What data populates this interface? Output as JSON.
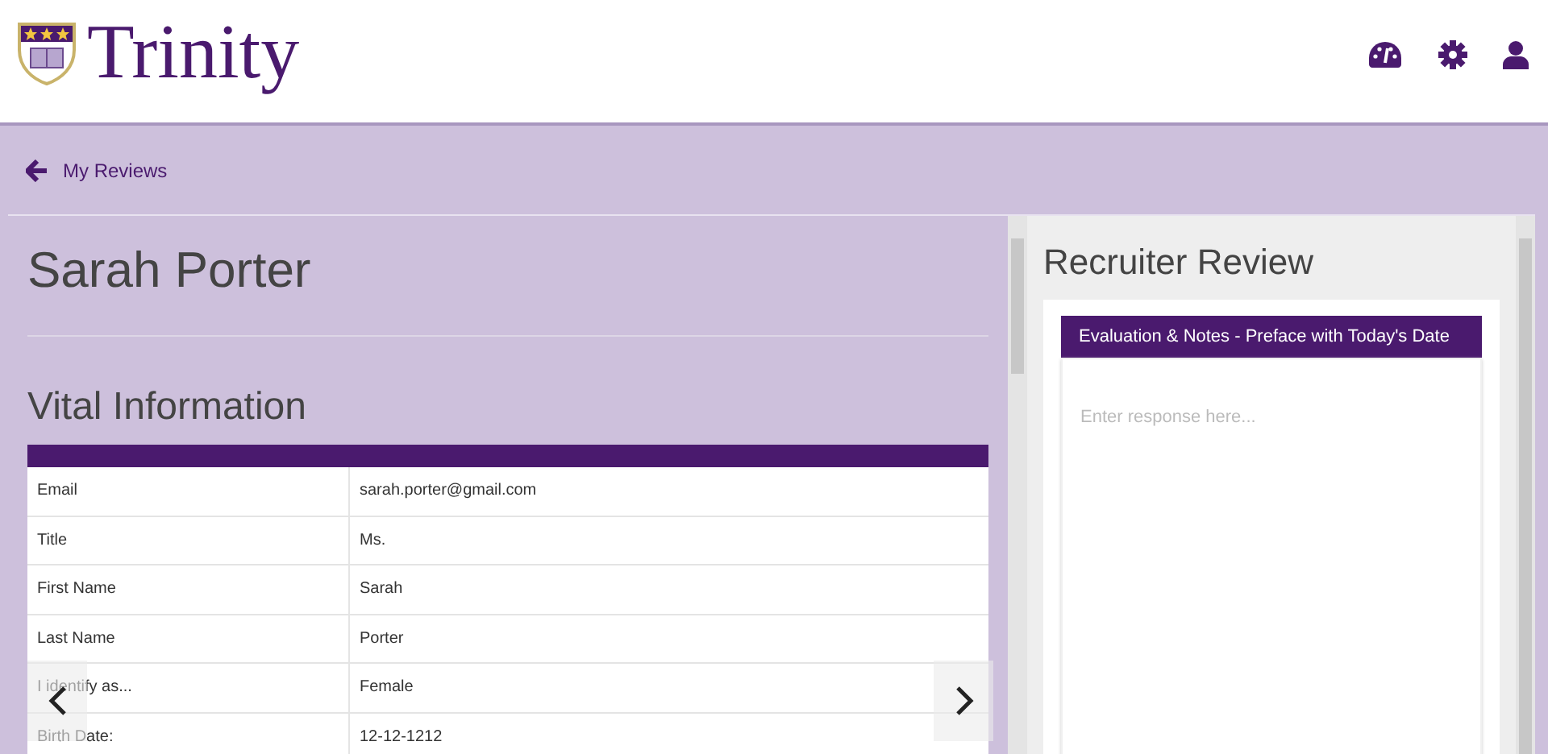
{
  "brand": {
    "name": "Trinity"
  },
  "back_link": {
    "label": "My Reviews"
  },
  "profile": {
    "name": "Sarah Porter",
    "section_title": "Vital Information",
    "rows": [
      {
        "label": "Email",
        "value": "sarah.porter@gmail.com"
      },
      {
        "label": "Title",
        "value": "Ms."
      },
      {
        "label": "First Name",
        "value": "Sarah"
      },
      {
        "label": "Last Name",
        "value": "Porter"
      },
      {
        "label": "I identify as...",
        "value": "Female"
      },
      {
        "label": "Birth Date:",
        "value": "12-12-1212"
      }
    ]
  },
  "review": {
    "title": "Recruiter Review",
    "card_title": "Evaluation & Notes - Preface with Today's Date",
    "placeholder": "Enter response here..."
  }
}
